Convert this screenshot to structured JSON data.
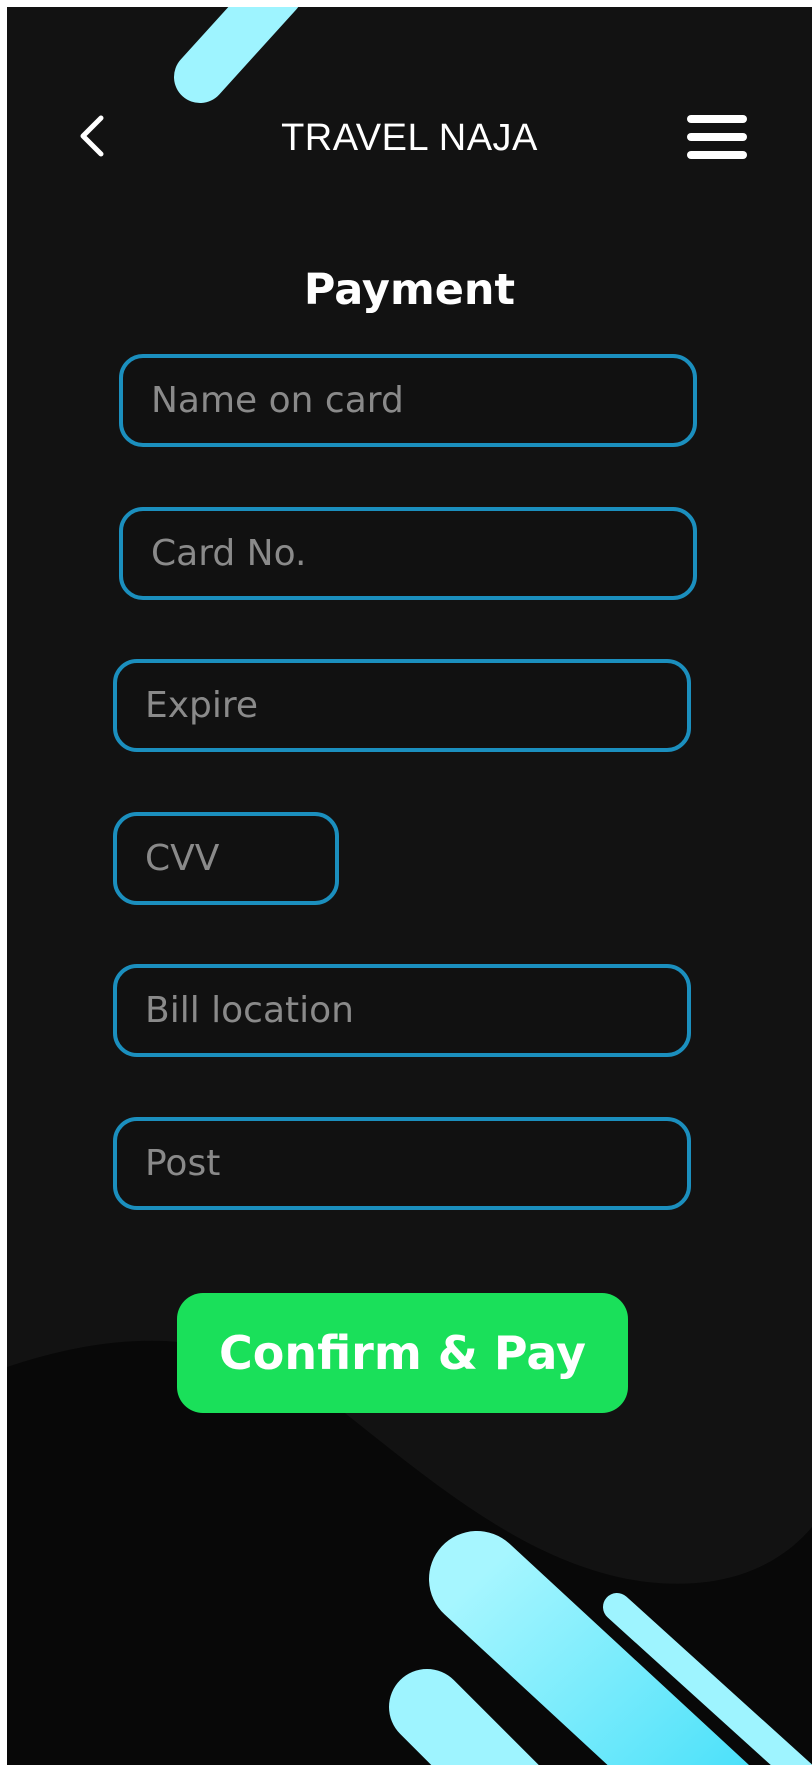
{
  "header": {
    "brand": "TRAVEL NAJA",
    "back_icon": "chevron-left-icon",
    "menu_icon": "hamburger-menu-icon"
  },
  "page_title": "Payment",
  "form": {
    "name_on_card": {
      "placeholder": "Name on card",
      "value": ""
    },
    "card_no": {
      "placeholder": "Card No.",
      "value": ""
    },
    "expire": {
      "placeholder": "Expire",
      "value": ""
    },
    "cvv": {
      "placeholder": "CVV",
      "value": ""
    },
    "bill_location": {
      "placeholder": "Bill location",
      "value": ""
    },
    "post": {
      "placeholder": "Post",
      "value": ""
    }
  },
  "confirm_label": "Confirm & Pay",
  "colors": {
    "background": "#121212",
    "field_border": "#1b8fbe",
    "placeholder_text": "#8a8a8a",
    "confirm_button": "#1ae05a",
    "accent_cyan": "#9ef4ff"
  }
}
